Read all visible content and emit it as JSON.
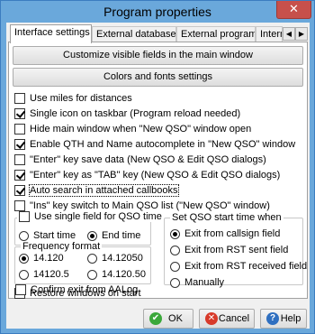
{
  "window": {
    "title": "Program properties",
    "close_glyph": "✕"
  },
  "tabs": [
    {
      "label": "Interface settings",
      "active": true
    },
    {
      "label": "External databases",
      "active": false
    },
    {
      "label": "External programs",
      "active": false
    },
    {
      "label": "Internet",
      "active": false
    }
  ],
  "tab_scroll": {
    "left": "◀",
    "right": "▶"
  },
  "buttons": {
    "customize": "Customize visible fields in the main window",
    "colors": "Colors and fonts settings"
  },
  "options": [
    {
      "label": "Use miles for distances",
      "checked": false
    },
    {
      "label": "Single icon on taskbar (Program reload needed)",
      "checked": true
    },
    {
      "label": "Hide main window when \"New QSO\" window open",
      "checked": false
    },
    {
      "label": "Enable QTH and Name autocomplete in \"New QSO\" window",
      "checked": true
    },
    {
      "label": "\"Enter\" key save data (New QSO & Edit QSO dialogs)",
      "checked": false
    },
    {
      "label": "\"Enter\" key as \"TAB\" key (New QSO & Edit QSO dialogs)",
      "checked": true
    },
    {
      "label": "Auto search in attached callbooks",
      "checked": true
    },
    {
      "label": "\"Ins\" key switch to Main QSO list (\"New QSO\" window)",
      "checked": false
    }
  ],
  "qso_time_group": {
    "checkbox_label": "Use single field for QSO time",
    "checked": false,
    "options": [
      {
        "label": "Start time",
        "selected": false
      },
      {
        "label": "End time",
        "selected": true
      }
    ]
  },
  "frequency_group": {
    "title": "Frequency format",
    "options": [
      {
        "label": "14.120",
        "selected": true
      },
      {
        "label": "14.12050",
        "selected": false
      },
      {
        "label": "14120.5",
        "selected": false
      },
      {
        "label": "14.120.50",
        "selected": false
      }
    ]
  },
  "start_time_group": {
    "title": "Set QSO start time when",
    "options": [
      {
        "label": "Exit from callsign field",
        "selected": true
      },
      {
        "label": "Exit from RST sent field",
        "selected": false
      },
      {
        "label": "Exit from RST received field",
        "selected": false
      },
      {
        "label": "Manually",
        "selected": false
      }
    ]
  },
  "bottom_options": [
    {
      "label": "Restore windows on start",
      "checked": false
    },
    {
      "label": "Confirm exit from AALog",
      "checked": false
    }
  ],
  "footer": {
    "ok": "OK",
    "cancel": "Cancel",
    "help": "Help"
  },
  "colors": {
    "title_bar": "#6aa8db",
    "close_button": "#c7504b",
    "ok_icon": "#3aa83a",
    "cancel_icon": "#d83a2a",
    "help_icon": "#2f6fc0"
  }
}
